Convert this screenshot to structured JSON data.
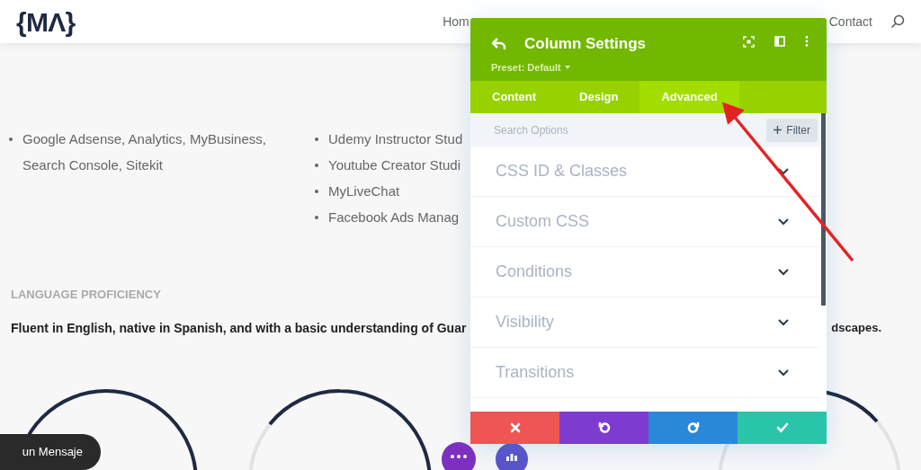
{
  "header": {
    "logo": "{MΛ}",
    "nav": [
      {
        "label": "Hom"
      },
      {
        "label": "Contact"
      }
    ]
  },
  "skills": {
    "column_1": [
      "Google Adsense, Analytics, MyBusiness, Search Console, Sitekit"
    ],
    "column_2": [
      "Udemy Instructor Stud",
      "Youtube Creator Studi",
      "MyLiveChat",
      "Facebook Ads Manag"
    ]
  },
  "language": {
    "heading": "LANGUAGE PROFICIENCY",
    "text_left": "Fluent in English, native in Spanish, and with a basic understanding of Guar",
    "text_right": "dscapes."
  },
  "chat_button": "un Mensaje",
  "settings_panel": {
    "title": "Column Settings",
    "preset": "Preset: Default",
    "tabs": [
      {
        "label": "Content",
        "selected": false
      },
      {
        "label": "Design",
        "selected": false
      },
      {
        "label": "Advanced",
        "selected": true
      }
    ],
    "search": {
      "placeholder": "Search Options"
    },
    "filter": "Filter",
    "sections": [
      {
        "label": "CSS ID & Classes"
      },
      {
        "label": "Custom CSS"
      },
      {
        "label": "Conditions"
      },
      {
        "label": "Visibility"
      },
      {
        "label": "Transitions"
      }
    ],
    "actions": [
      {
        "kind": "discard"
      },
      {
        "kind": "undo"
      },
      {
        "kind": "redo"
      },
      {
        "kind": "save"
      }
    ]
  }
}
